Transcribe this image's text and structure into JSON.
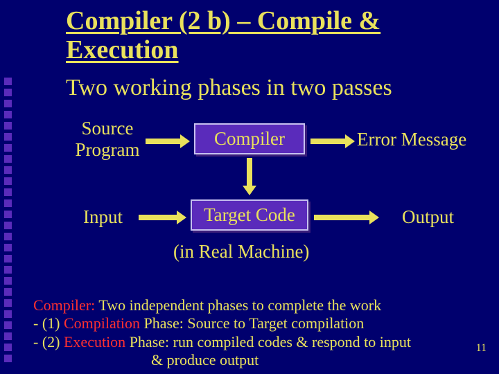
{
  "title": "Compiler (2 b) – Compile & Execution",
  "subtitle": "Two working phases in two passes",
  "diagram": {
    "source_program_l1": "Source",
    "source_program_l2": "Program",
    "compiler_box": "Compiler",
    "error_message": "Error Message",
    "input_label": "Input",
    "target_box": "Target Code",
    "output_label": "Output",
    "subcaption": "(in Real Machine)"
  },
  "footer": {
    "lead_red": "Compiler:",
    "lead_rest": " Two independent phases to complete the work",
    "l2a": "- (1) ",
    "l2red": "Compilation",
    "l2b": " Phase: Source to Target compilation",
    "l3a": "- (2) ",
    "l3red": "Execution",
    "l3b": " Phase: run compiled codes & respond to input",
    "l4": "& produce output"
  },
  "page_number": "11"
}
